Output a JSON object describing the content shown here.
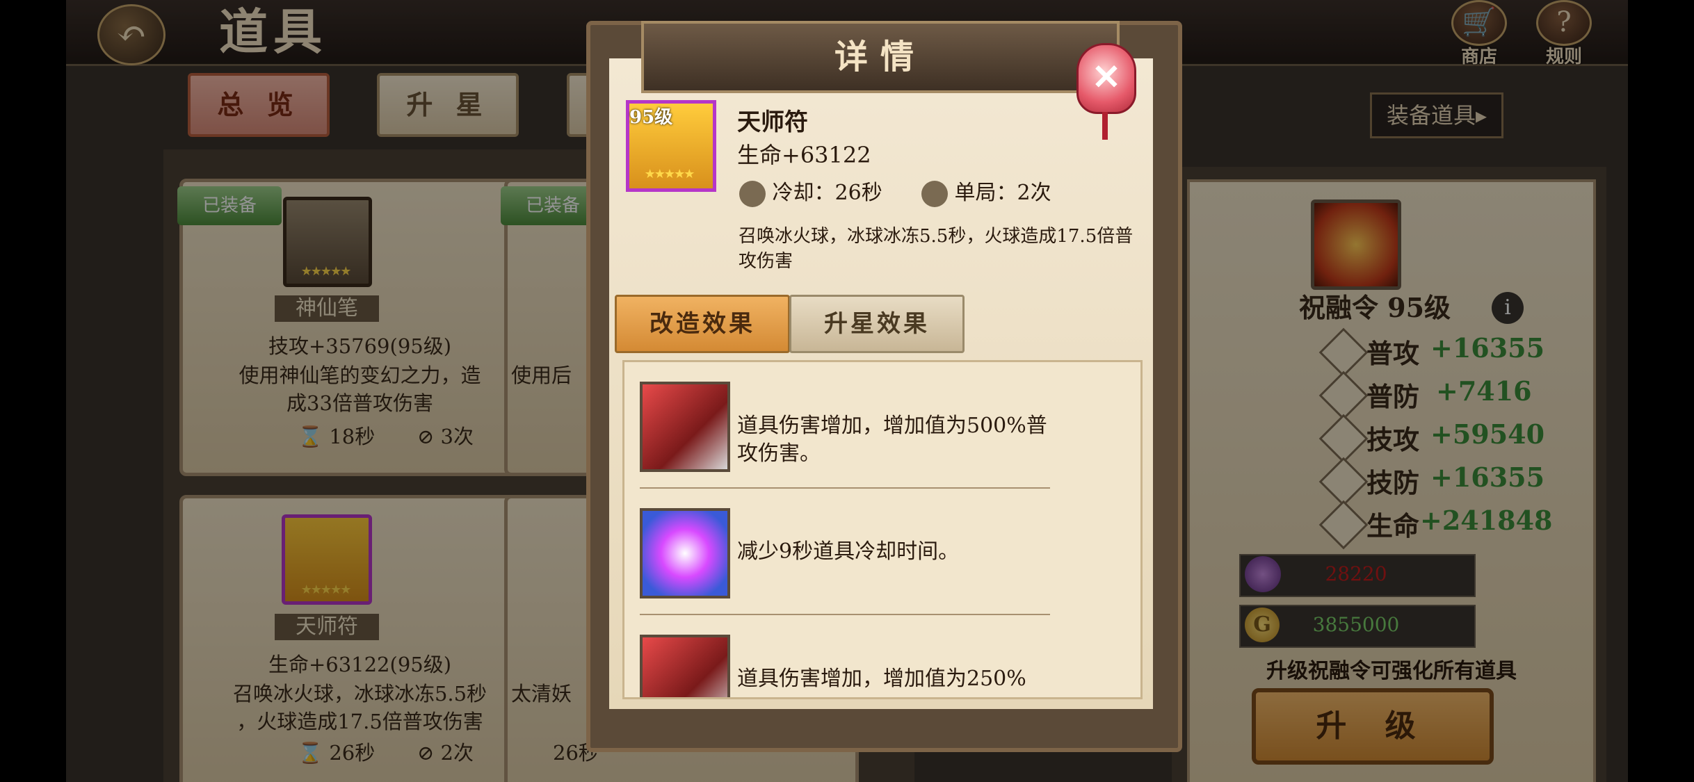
{
  "header": {
    "title": "道具",
    "shop_label": "商店",
    "rules_label": "规则"
  },
  "tabs": [
    {
      "label": "总 览",
      "active": true
    },
    {
      "label": "升 星",
      "active": false
    }
  ],
  "equip_button": "装备道具▸",
  "cards": [
    {
      "badge": "已装备",
      "name": "神仙笔",
      "stat": "技攻+35769(95级)",
      "desc": [
        "使用神仙笔的变幻之力，造",
        "成33倍普攻伤害"
      ],
      "cooldown": "18秒",
      "uses": "3次"
    },
    {
      "badge": "已装备",
      "name": "",
      "stat": "",
      "desc": [
        "使用后"
      ],
      "cooldown": "",
      "uses": ""
    },
    {
      "name": "天师符",
      "stat": "生命+63122(95级)",
      "desc": [
        "召唤冰火球，冰球冰冻5.5秒",
        "，火球造成17.5倍普攻伤害"
      ],
      "cooldown": "26秒",
      "uses": "2次"
    },
    {
      "name": "",
      "stat": "",
      "desc": [
        "太清妖"
      ],
      "cooldown": "26秒",
      "uses": ""
    }
  ],
  "right_panel": {
    "title": "祝融令 95级",
    "stats": [
      {
        "name": "普攻",
        "value": "+16355"
      },
      {
        "name": "普防",
        "value": "+7416"
      },
      {
        "name": "技攻",
        "value": "+59540"
      },
      {
        "name": "技防",
        "value": "+16355"
      },
      {
        "name": "生命",
        "value": "+241848"
      }
    ],
    "resource_gem": "28220",
    "resource_gold": "3855000",
    "hint": "升级祝融令可强化所有道具",
    "upgrade_label": "升 级",
    "colors": {
      "stat_value": "#3c8c3a",
      "gem_value": "#c21c1c",
      "gold_value": "#7bd06a"
    }
  },
  "modal": {
    "title": "详情",
    "close_label": "✕",
    "item": {
      "level": "95级",
      "name": "天师符",
      "stat": "生命+63122",
      "cooldown": "冷却：26秒",
      "uses": "单局：2次",
      "description": "召唤冰火球，冰球冰冻5.5秒，火球造成17.5倍普攻伤害"
    },
    "tabs": [
      {
        "label": "改造效果",
        "active": true
      },
      {
        "label": "升星效果",
        "active": false
      }
    ],
    "effects": [
      {
        "icon": "sword-slash-icon",
        "text": "道具伤害增加，增加值为500%普攻伤害。"
      },
      {
        "icon": "vortex-icon",
        "text": "减少9秒道具冷却时间。"
      },
      {
        "icon": "sword-slash-icon",
        "text": "道具伤害增加，增加值为250%"
      }
    ]
  }
}
